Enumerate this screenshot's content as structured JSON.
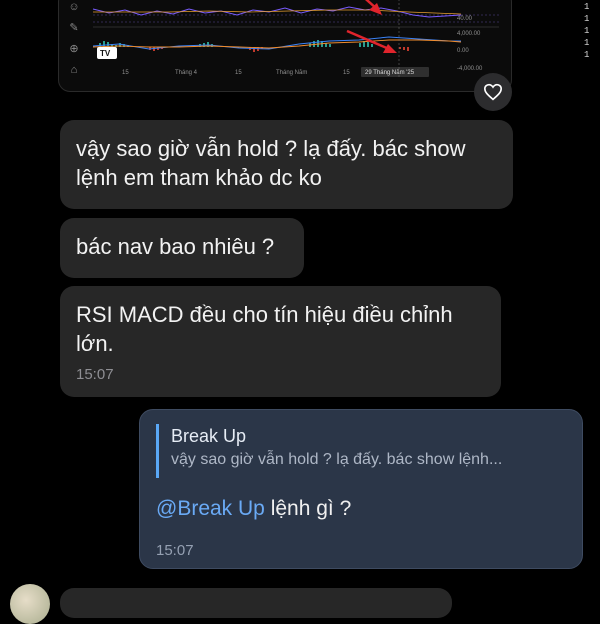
{
  "chart": {
    "x_ticks": [
      "15",
      "Tháng 4",
      "15",
      "Tháng Năm",
      "15"
    ],
    "date_badge": "29 Tháng Năm '25",
    "y_labels": [
      "40.00",
      "4,000.00",
      "0.00",
      "-4,000.00"
    ],
    "logo": "TV",
    "right_edge_glyphs": [
      "1",
      "1",
      "1",
      "1",
      "1"
    ]
  },
  "messages": [
    {
      "text": "vậy sao giờ vẫn hold ? lạ đấy. bác show lệnh em tham khảo dc ko",
      "time": ""
    },
    {
      "text": "bác nav bao nhiêu ?",
      "time": ""
    },
    {
      "text": "RSI MACD đều cho tín hiệu điều chỉnh lớn.",
      "time": "15:07"
    }
  ],
  "reply": {
    "quoted_author": "Break Up",
    "quoted_text": "vậy sao giờ vẫn hold ? lạ đấy. bác show lệnh...",
    "mention": "@Break Up",
    "text": " lệnh gì ?",
    "time": "15:07"
  },
  "colors": {
    "incoming_bubble": "#272727",
    "outgoing_bubble": "#2b3648",
    "accent": "#5aa8f6",
    "arrow_red": "#e0242c"
  }
}
